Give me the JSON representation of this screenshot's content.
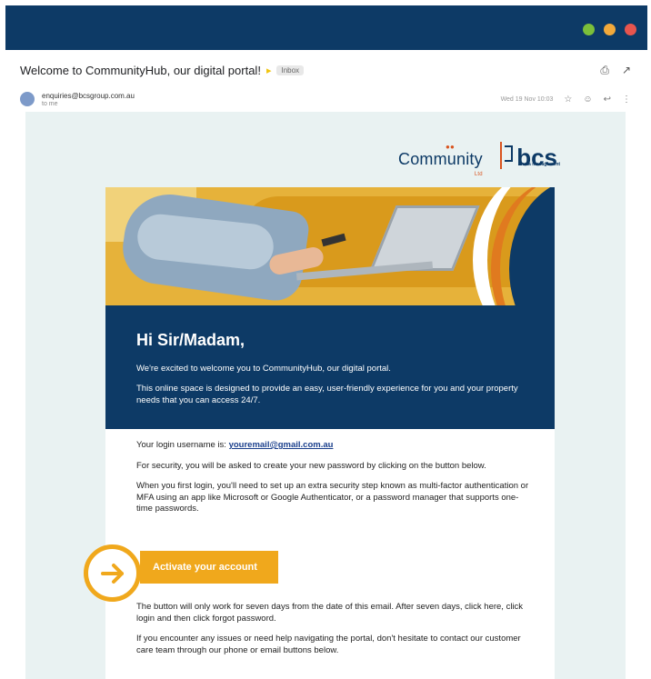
{
  "window": {
    "controls": [
      {
        "name": "minimize",
        "color": "#7bbf3a"
      },
      {
        "name": "maximize",
        "color": "#f2a93b"
      },
      {
        "name": "close",
        "color": "#e8554e"
      }
    ]
  },
  "email": {
    "subject": "Welcome to CommunityHub, our digital portal!",
    "label": "Inbox",
    "sender_email": "enquiries@bcsgroup.com.au",
    "sender_to": "to me",
    "date": "Wed 19 Nov 10:03",
    "icons": {
      "print": "print-icon",
      "open_new": "open-in-new-icon",
      "star": "star-icon",
      "emoji": "emoji-icon",
      "reply": "reply-icon",
      "more": "more-vert-icon"
    }
  },
  "brand": {
    "community": "Community",
    "community_suffix": "Ltd",
    "bcs": "bcs",
    "bcs_sub": "strata management",
    "navy": "#0d3a66",
    "orange": "#f0a81c",
    "background": "#e9f2f2"
  },
  "banner": {
    "greeting": "Hi Sir/Madam,",
    "line1": "We're excited to welcome you to CommunityHub, our digital portal.",
    "line2": "This online space is designed to provide an easy, user-friendly experience for you and your property needs that you can access 24/7."
  },
  "body": {
    "username_prefix": "Your login username is:",
    "username": "youremail@gmail.com.au",
    "security": "For security, you will be asked to create your new password by clicking on the button below.",
    "mfa": "When you first login, you'll need to set up an extra security step known as multi-factor authentication or MFA using an app like Microsoft or Google Authenticator, or a password manager that supports one-time passwords.",
    "button_label": "Activate your account",
    "expiry": "The button will only work for seven days from the date of this email. After seven days, click here, click login and then click forgot password.",
    "help": "If you encounter any issues or need help navigating the portal, don't hesitate to contact our customer care team through our phone or email buttons below."
  }
}
